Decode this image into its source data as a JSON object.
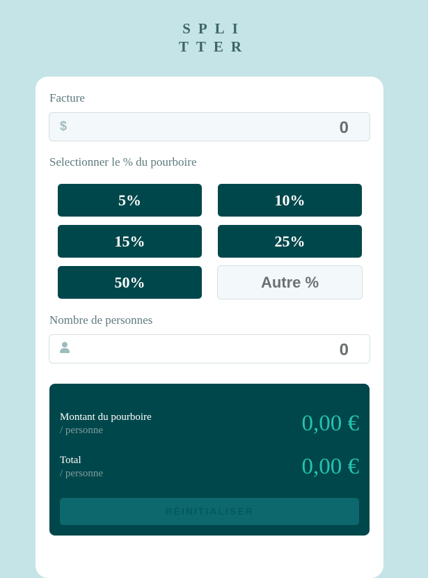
{
  "app": {
    "logo_line1": "SPLI",
    "logo_line2": "TTER"
  },
  "bill": {
    "label": "Facture",
    "currency_symbol": "$",
    "value": "0"
  },
  "tip": {
    "label": "Selectionner le % du pourboire",
    "options": [
      "5%",
      "10%",
      "15%",
      "25%",
      "50%"
    ],
    "custom_placeholder": "Autre %"
  },
  "people": {
    "label": "Nombre de personnes",
    "value": "0",
    "icon": "person-icon"
  },
  "results": {
    "tip_amount_label": "Montant du pourboire",
    "tip_amount_sub": "/ personne",
    "tip_amount_value": "0,00 €",
    "total_label": "Total",
    "total_sub": "/ personne",
    "total_value": "0,00 €",
    "reset_label": "RÉINITIALISER"
  },
  "colors": {
    "background": "#c5e4e7",
    "dark_cyan": "#00474b",
    "accent": "#26c2ae",
    "card": "#ffffff"
  }
}
